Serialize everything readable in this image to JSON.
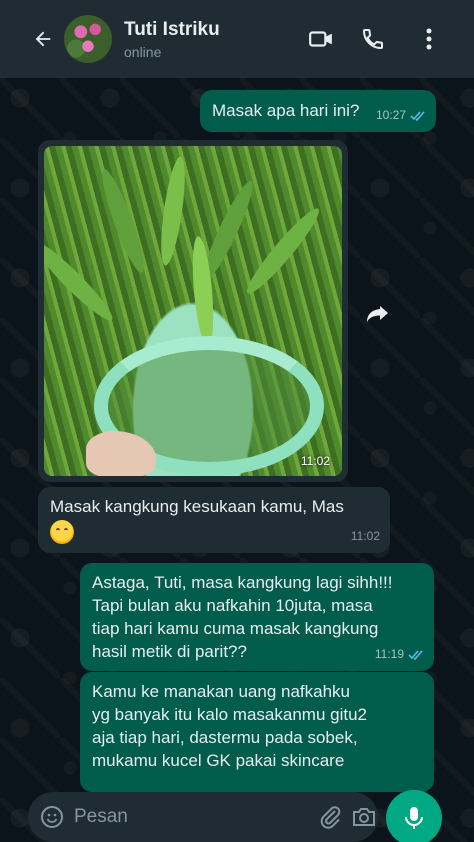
{
  "header": {
    "contact_name": "Tuti Istriku",
    "status": "online",
    "back_icon": "arrow-left-icon",
    "video_icon": "video-camera-icon",
    "call_icon": "phone-icon",
    "menu_icon": "more-vertical-icon"
  },
  "messages": [
    {
      "direction": "out",
      "text": "Masak apa hari ini?",
      "time": "10:27",
      "status": "read"
    },
    {
      "direction": "in",
      "type": "image",
      "time": "11:02"
    },
    {
      "direction": "in",
      "text": "Masak kangkung kesukaan kamu, Mas",
      "emoji": "smiling-face",
      "time": "11:02"
    },
    {
      "direction": "out",
      "lines": [
        "Astaga, Tuti, masa kangkung lagi sihh!!!",
        "Tapi bulan aku nafkahin 10juta, masa",
        "tiap hari kamu cuma masak kangkung",
        "hasil metik di parit??"
      ],
      "time": "11:19",
      "status": "read"
    },
    {
      "direction": "out",
      "lines": [
        "Kamu ke manakan uang nafkahku",
        "yg banyak itu kalo masakanmu gitu2",
        "aja tiap hari, dastermu pada sobek,",
        "mukamu kucel GK pakai skincare"
      ]
    }
  ],
  "input": {
    "placeholder": "Pesan",
    "value": ""
  },
  "colors": {
    "background": "#0b141a",
    "header": "#1f2c34",
    "outgoing_bubble": "#005c4b",
    "incoming_bubble": "#1f2c34",
    "read_ticks": "#53bdeb",
    "mic_button": "#00a884"
  }
}
